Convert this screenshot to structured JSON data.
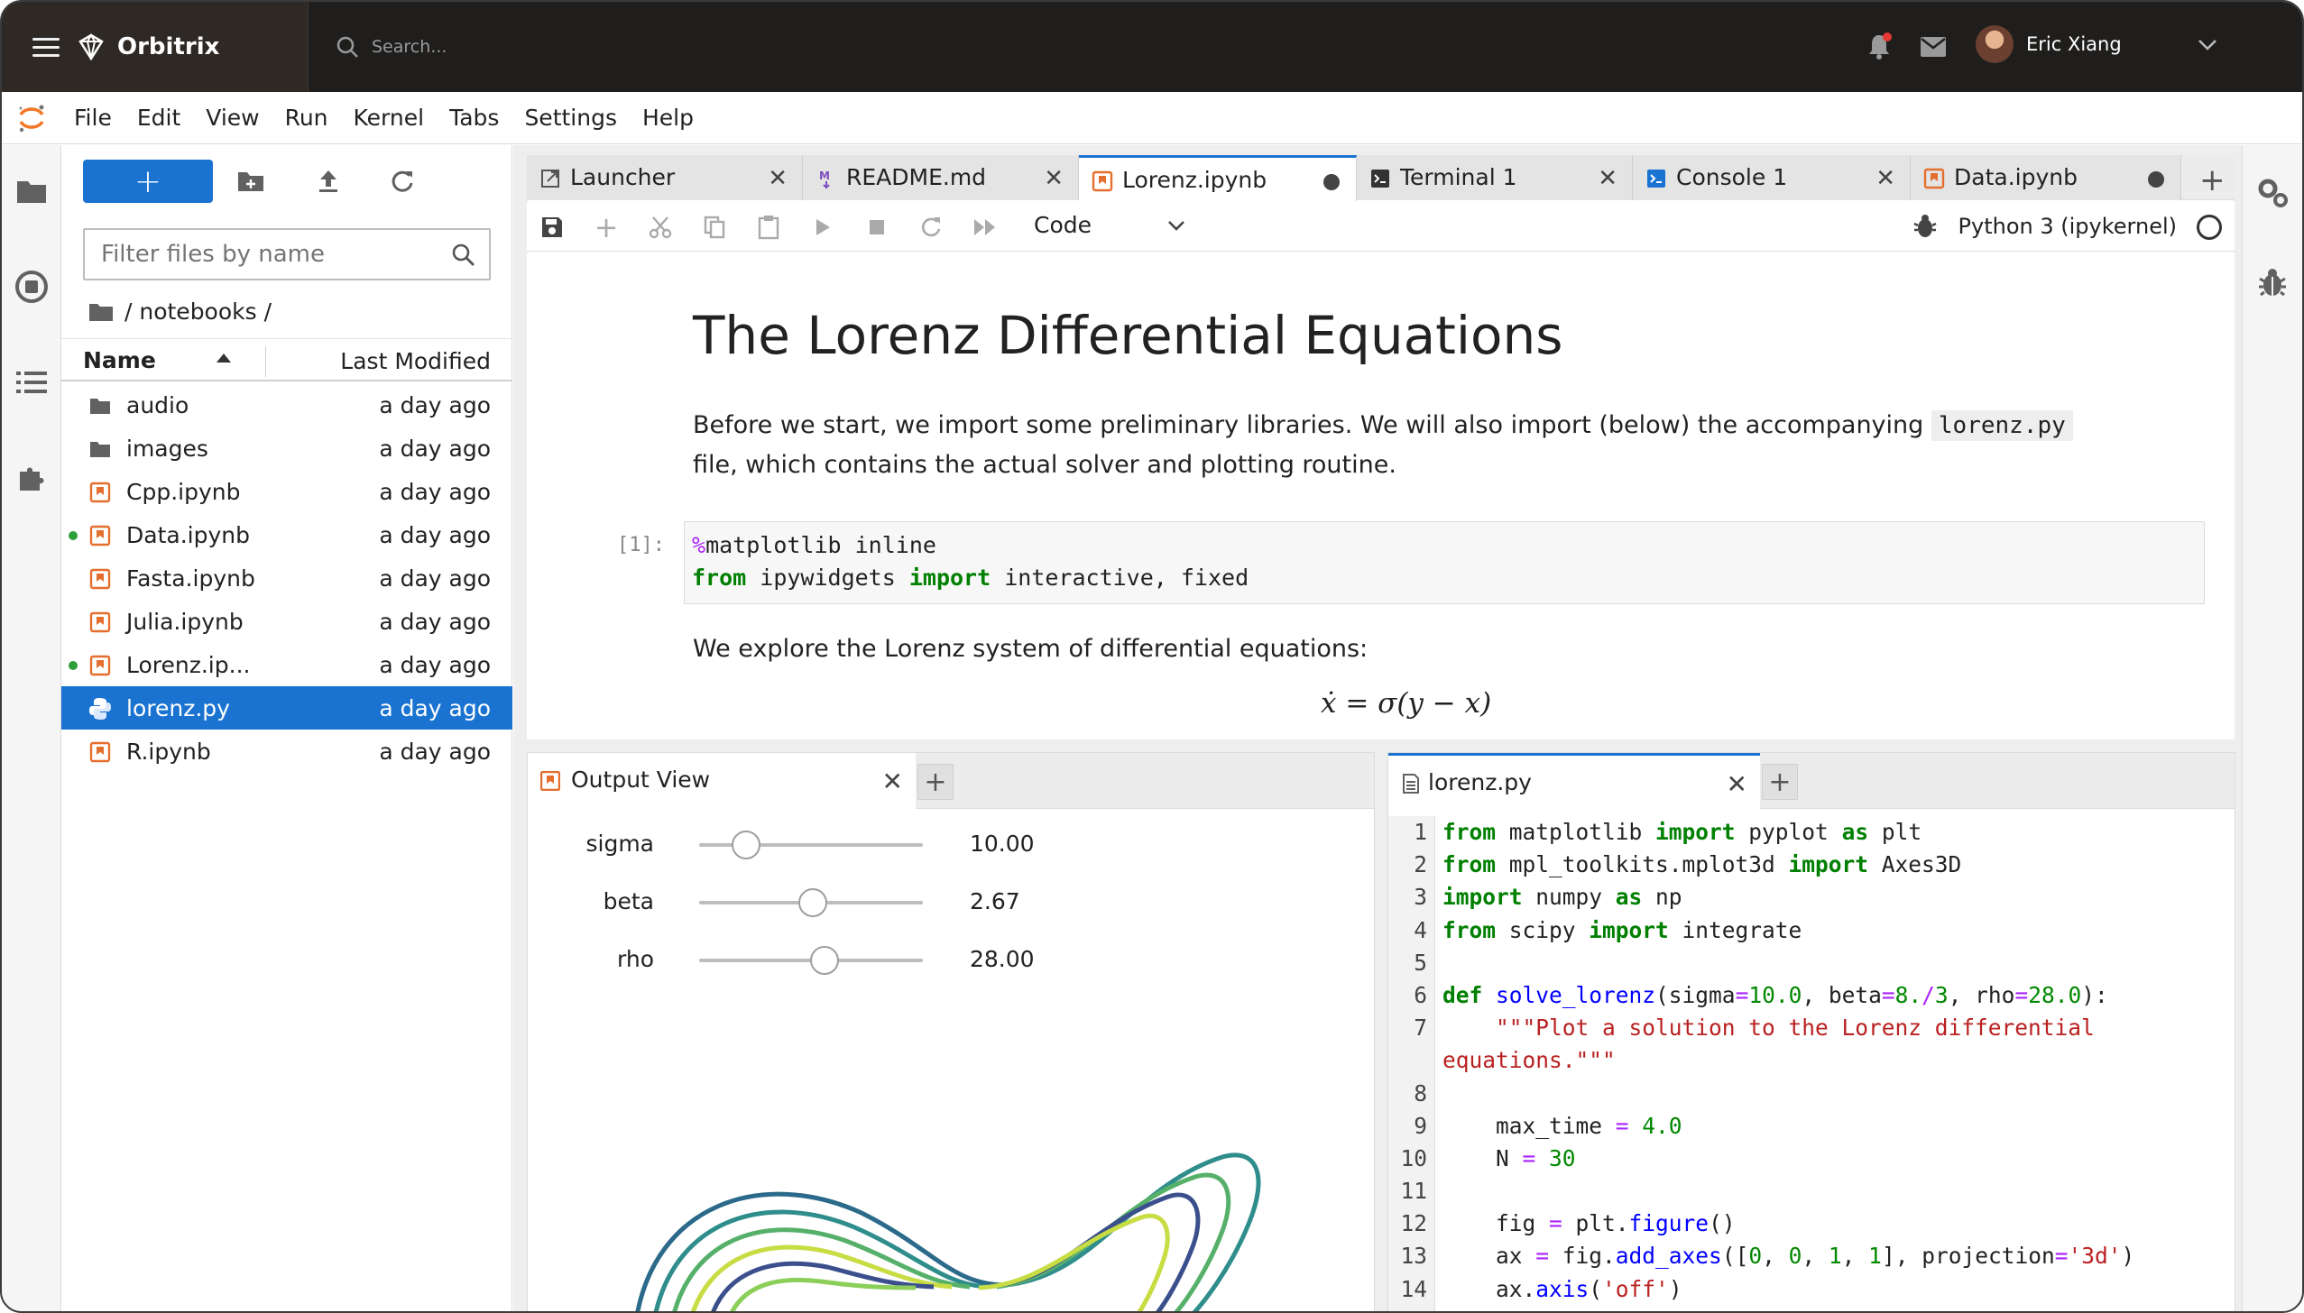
{
  "app": {
    "name": "Orbitrix",
    "search_placeholder": "Search...",
    "user_name": "Eric Xiang"
  },
  "menu": [
    "File",
    "Edit",
    "View",
    "Run",
    "Kernel",
    "Tabs",
    "Settings",
    "Help"
  ],
  "filebrowser": {
    "filter_placeholder": "Filter files by name",
    "breadcrumb": "/ notebooks /",
    "col_name": "Name",
    "col_modified": "Last Modified",
    "files": [
      {
        "name": "audio",
        "modified": "a day ago",
        "icon": "folder-icon",
        "running": false,
        "selected": false
      },
      {
        "name": "images",
        "modified": "a day ago",
        "icon": "folder-icon",
        "running": false,
        "selected": false
      },
      {
        "name": "Cpp.ipynb",
        "modified": "a day ago",
        "icon": "notebook-icon",
        "running": false,
        "selected": false
      },
      {
        "name": "Data.ipynb",
        "modified": "a day ago",
        "icon": "notebook-icon",
        "running": true,
        "selected": false
      },
      {
        "name": "Fasta.ipynb",
        "modified": "a day ago",
        "icon": "notebook-icon",
        "running": false,
        "selected": false
      },
      {
        "name": "Julia.ipynb",
        "modified": "a day ago",
        "icon": "notebook-icon",
        "running": false,
        "selected": false
      },
      {
        "name": "Lorenz.ip...",
        "modified": "a day ago",
        "icon": "notebook-icon",
        "running": true,
        "selected": false
      },
      {
        "name": "lorenz.py",
        "modified": "a day ago",
        "icon": "python-icon",
        "running": false,
        "selected": true
      },
      {
        "name": "R.ipynb",
        "modified": "a day ago",
        "icon": "notebook-icon",
        "running": false,
        "selected": false
      }
    ]
  },
  "tabs": [
    {
      "label": "Launcher",
      "icon": "launcher-icon",
      "dirty": false,
      "active": false
    },
    {
      "label": "README.md",
      "icon": "markdown-icon",
      "dirty": false,
      "active": false
    },
    {
      "label": "Lorenz.ipynb",
      "icon": "notebook-icon",
      "dirty": true,
      "active": true
    },
    {
      "label": "Terminal 1",
      "icon": "terminal-icon",
      "dirty": false,
      "active": false
    },
    {
      "label": "Console 1",
      "icon": "console-icon",
      "dirty": false,
      "active": false
    },
    {
      "label": "Data.ipynb",
      "icon": "notebook-icon",
      "dirty": true,
      "active": false
    }
  ],
  "toolbar": {
    "cell_type": "Code",
    "kernel_name": "Python 3 (ipykernel)"
  },
  "notebook": {
    "title": "The Lorenz Differential Equations",
    "intro_before": "Before we start, we import some preliminary libraries. We will also import (below) the accompanying",
    "intro_code": "lorenz.py",
    "intro_after": "file, which contains the actual solver and plotting routine.",
    "prompt": "[1]:",
    "cell_line1_magic": "%",
    "cell_line1_rest": "matplotlib inline",
    "cell_line2_from": "from",
    "cell_line2_mod": " ipywidgets ",
    "cell_line2_import": "import",
    "cell_line2_rest": " interactive, fixed",
    "explore_text": "We explore the Lorenz system of differential equations:",
    "equation": "ẋ = σ(y − x)"
  },
  "output_view": {
    "tab_label": "Output View",
    "sliders": [
      {
        "label": "sigma",
        "value": "10.00",
        "fraction": 0.21
      },
      {
        "label": "beta",
        "value": "2.67",
        "fraction": 0.51
      },
      {
        "label": "rho",
        "value": "28.00",
        "fraction": 0.56
      }
    ]
  },
  "editor": {
    "tab_label": "lorenz.py",
    "line_numbers": [
      "1",
      "2",
      "3",
      "4",
      "5",
      "6",
      "7",
      "",
      "8",
      "9",
      "10",
      "11",
      "12",
      "13",
      "14"
    ]
  },
  "colors": {
    "accent": "#1a73d1",
    "topbar": "#1f1e1d",
    "running_dot": "#2e9e3a",
    "notebook_orange": "#e46e2e"
  }
}
